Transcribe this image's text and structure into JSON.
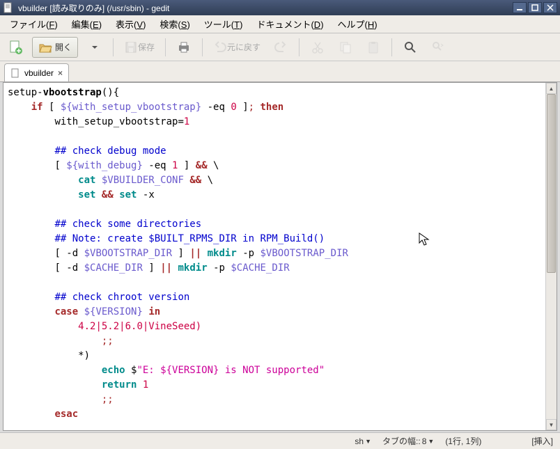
{
  "window": {
    "title": "vbuilder [読み取りのみ] (/usr/sbin) - gedit"
  },
  "menubar": [
    {
      "label": "ファイル",
      "accel": "F"
    },
    {
      "label": "編集",
      "accel": "E"
    },
    {
      "label": "表示",
      "accel": "V"
    },
    {
      "label": "検索",
      "accel": "S"
    },
    {
      "label": "ツール",
      "accel": "T"
    },
    {
      "label": "ドキュメント",
      "accel": "D"
    },
    {
      "label": "ヘルプ",
      "accel": "H"
    }
  ],
  "toolbar": {
    "open": "開く",
    "save": "保存",
    "undo": "元に戻す"
  },
  "tab": {
    "name": "vbuilder"
  },
  "code": {
    "l1_a": "setup-",
    "l1_b": "vbootstrap",
    "l1_c": "(){",
    "l2_a": "if",
    "l2_b": " [ ",
    "l2_c": "${with_setup_vbootstrap}",
    "l2_d": " -eq ",
    "l2_e": "0",
    "l2_f": " ]",
    "l2_g": "; ",
    "l2_h": "then",
    "l3_a": "with_setup_vbootstrap=",
    "l3_b": "1",
    "l5": "## check debug mode",
    "l6_a": "[ ",
    "l6_b": "${with_debug}",
    "l6_c": " -eq ",
    "l6_d": "1",
    "l6_e": " ] ",
    "l6_f": "&&",
    "l6_g": " \\",
    "l7_a": "cat",
    "l7_b": " $VBUILDER_CONF ",
    "l7_c": "&&",
    "l7_d": " \\",
    "l8_a": "set",
    "l8_b": " ",
    "l8_c": "&&",
    "l8_d": " ",
    "l8_e": "set",
    "l8_f": " -x",
    "l10": "## check some directories",
    "l11": "## Note: create $BUILT_RPMS_DIR in RPM_Build()",
    "l12_a": "[ -d ",
    "l12_b": "$VBOOTSTRAP_DIR",
    "l12_c": " ] ",
    "l12_d": "||",
    "l12_e": " ",
    "l12_f": "mkdir",
    "l12_g": " -p ",
    "l12_h": "$VBOOTSTRAP_DIR",
    "l13_a": "[ -d ",
    "l13_b": "$CACHE_DIR",
    "l13_c": " ] ",
    "l13_d": "||",
    "l13_e": " ",
    "l13_f": "mkdir",
    "l13_g": " -p ",
    "l13_h": "$CACHE_DIR",
    "l15": "## check chroot version",
    "l16_a": "case",
    "l16_b": " ",
    "l16_c": "${VERSION}",
    "l16_d": " ",
    "l16_e": "in",
    "l17_a": "4.2|5.2|6.0|VineSeed)",
    "l18": ";;",
    "l19": "*)",
    "l20_a": "echo",
    "l20_b": " $",
    "l20_c": "\"E: ${VERSION} is NOT supported\"",
    "l21_a": "return",
    "l21_b": " ",
    "l21_c": "1",
    "l22": ";;",
    "l23": "esac"
  },
  "statusbar": {
    "lang": "sh",
    "tabwidth_label": "タブの幅::",
    "tabwidth": "8",
    "cursor": "(1行, 1列)",
    "mode": "[挿入]"
  },
  "icons": {
    "app": "app-icon"
  }
}
